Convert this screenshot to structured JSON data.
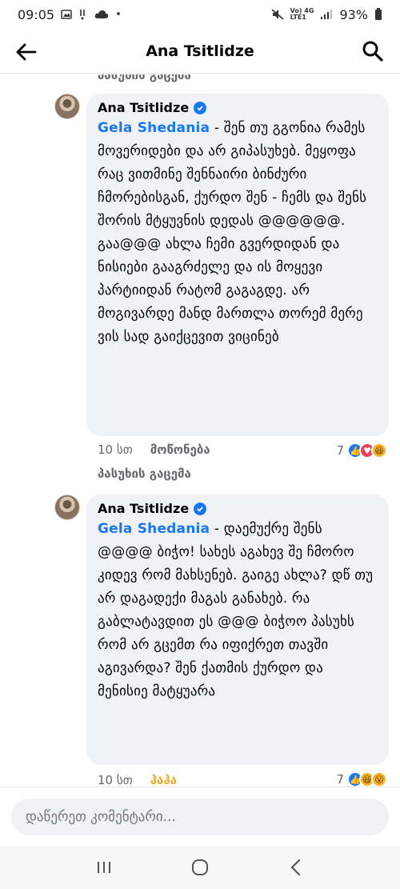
{
  "status_bar": {
    "time": "09:05",
    "network": "Vo) 4G\nLTE1",
    "battery": "93%"
  },
  "header": {
    "title": "Ana Tsitlidze"
  },
  "feed": {
    "cut_reply_label": "პასუხის გაცემა",
    "comments": [
      {
        "author": "Ana Tsitlidze",
        "mention": "Gela Shedania",
        "text": " - შენ თუ გგონია რამეს მოვერიდები და არ გიპასუხებ. მეყოფა რაც ვითმინე შენნაირი ბინძური ჩმორებისგან, ქურდო შენ - ჩემს და შენს შორის მტყუვნის დედას @@@@@@. გაა@@@ ახლა ჩემი გვერდიდან და ნისიები გააგრძელე და ის მოყევი პარტიიდან რატომ გაგაგდე. არ მოგივარდე მანდ მართლა თორემ მერე ვის სად გაიქცევით ვიცინებ",
        "time": "10 სთ",
        "action": "მოწონება",
        "reply": "პასუხის გაცემა",
        "reaction_count": "7",
        "reactions": [
          "like",
          "love",
          "haha"
        ]
      },
      {
        "author": "Ana Tsitlidze",
        "mention": "Gela Shedania",
        "text": " - დაემუქრე შენს @@@@ ბიჭო! სახეს აგახევ შე ჩმორო კიდევ რომ მახსენებ. გაიგე ახლა? დწ თუ არ დაგადექი მაგას განახებ. რა გაბლატავდით ეს @@@ ბიჭოო პასუხს რომ არ გცემთ რა იფიქრეთ თავში აგივარდა? შენ ქათმის ქურდო და მენისიე მატყუარა",
        "time": "10 სთ",
        "action": "ჰაჰა",
        "reaction_count": "7",
        "reactions": [
          "like",
          "haha",
          "wow"
        ]
      }
    ]
  },
  "composer": {
    "placeholder": "დაწერეთ კომენტარი..."
  },
  "colors": {
    "accent": "#1877f2",
    "bubble": "#f0f2f5",
    "haha": "#f5a623"
  }
}
